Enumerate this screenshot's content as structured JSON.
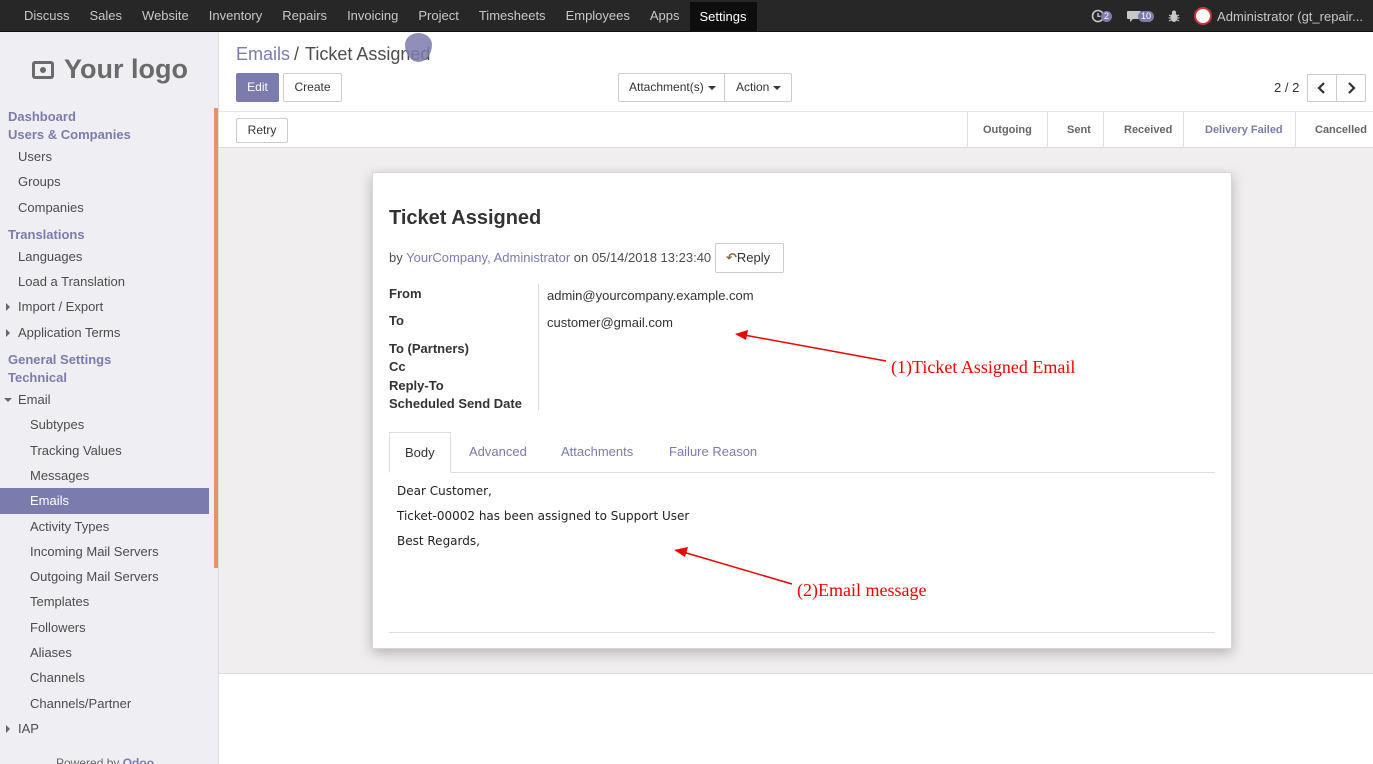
{
  "topbar": {
    "menu": [
      "Discuss",
      "Sales",
      "Website",
      "Inventory",
      "Repairs",
      "Invoicing",
      "Project",
      "Timesheets",
      "Employees",
      "Apps",
      "Settings"
    ],
    "active": "Settings",
    "activity_count": "2",
    "message_count": "10",
    "user_label": "Administrator (gt_repair..."
  },
  "sidebar": {
    "logo_text": "Your logo",
    "items": [
      {
        "label": "Dashboard",
        "kind": "cat"
      },
      {
        "label": "Users & Companies",
        "kind": "cat"
      },
      {
        "label": "Users",
        "kind": "l1"
      },
      {
        "label": "Groups",
        "kind": "l1"
      },
      {
        "label": "Companies",
        "kind": "l1"
      },
      {
        "label": "Translations",
        "kind": "cat"
      },
      {
        "label": "Languages",
        "kind": "l1"
      },
      {
        "label": "Load a Translation",
        "kind": "l1"
      },
      {
        "label": "Import / Export",
        "kind": "l1"
      },
      {
        "label": "Application Terms",
        "kind": "l1"
      },
      {
        "label": "General Settings",
        "kind": "cat"
      },
      {
        "label": "Technical",
        "kind": "cat"
      },
      {
        "label": "Email",
        "kind": "l1"
      },
      {
        "label": "Subtypes",
        "kind": "l2"
      },
      {
        "label": "Tracking Values",
        "kind": "l2"
      },
      {
        "label": "Messages",
        "kind": "l2"
      },
      {
        "label": "Emails",
        "kind": "l2"
      },
      {
        "label": "Activity Types",
        "kind": "l2"
      },
      {
        "label": "Incoming Mail Servers",
        "kind": "l2"
      },
      {
        "label": "Outgoing Mail Servers",
        "kind": "l2"
      },
      {
        "label": "Templates",
        "kind": "l2"
      },
      {
        "label": "Followers",
        "kind": "l2"
      },
      {
        "label": "Aliases",
        "kind": "l2"
      },
      {
        "label": "Channels",
        "kind": "l2"
      },
      {
        "label": "Channels/Partner",
        "kind": "l2"
      },
      {
        "label": "IAP",
        "kind": "l1"
      }
    ],
    "selected": "Emails",
    "powered_prefix": "Powered by",
    "powered_brand": "Odoo"
  },
  "control_panel": {
    "breadcrumb_parent": "Emails",
    "breadcrumb_separator": "/",
    "breadcrumb_current": "Ticket Assigned",
    "edit_label": "Edit",
    "create_label": "Create",
    "attachments_label": "Attachment(s)",
    "action_label": "Action",
    "pager": "2 / 2"
  },
  "statusbar": {
    "retry_label": "Retry",
    "states": [
      "Outgoing",
      "Sent",
      "Received",
      "Delivery Failed",
      "Cancelled"
    ],
    "current": "Delivery Failed"
  },
  "mail": {
    "subject": "Ticket Assigned",
    "by_prefix": "by",
    "author_company": "YourCompany,",
    "author_name": "Administrator",
    "date_text": "on 05/14/2018 13:23:40",
    "reply_label": "Reply",
    "fields": {
      "from_label": "From",
      "from_value": "admin@yourcompany.example.com",
      "to_label": "To",
      "to_value": "customer@gmail.com",
      "to_partners_label": "To (Partners)",
      "cc_label": "Cc",
      "reply_to_label": "Reply-To",
      "scheduled_label": "Scheduled Send Date"
    },
    "tabs": [
      "Body",
      "Advanced",
      "Attachments",
      "Failure Reason"
    ],
    "active_tab": "Body",
    "body_lines": [
      "Dear Customer,",
      "Ticket-00002 has been assigned to Support User",
      "Best Regards,"
    ]
  },
  "annotations": {
    "note1": "(1)Ticket Assigned Email",
    "note2": "(2)Email message",
    "color": "#e00000"
  },
  "colors": {
    "brand": "#7c7bad",
    "topbar": "#272727"
  }
}
